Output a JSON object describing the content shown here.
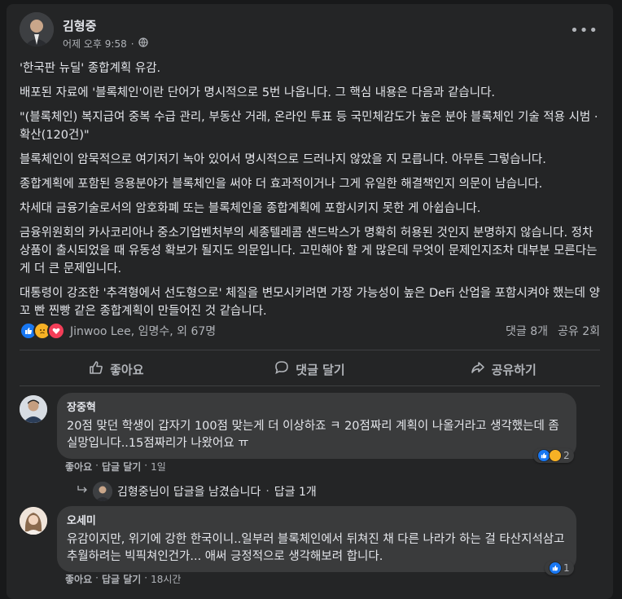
{
  "post": {
    "author": "김형중",
    "time": "어제 오후 9:58",
    "dot": "·",
    "more": "•••",
    "paragraphs": [
      "'한국판 뉴딜' 종합계획 유감.",
      "배포된 자료에 '블록체인'이란 단어가 명시적으로 5번 나옵니다. 그 핵심 내용은 다음과 같습니다.",
      "\"(블록체인) 복지급여 중복 수급 관리, 부동산 거래, 온라인 투표 등 국민체감도가 높은 분야 블록체인 기술 적용 시범 · 확산(120건)\"",
      "블록체인이 암묵적으로 여기저기 녹아 있어서 명시적으로 드러나지 않았을 지 모릅니다. 아무튼 그렇습니다.",
      "종합계획에 포함된 응용분야가 블록체인을 써야 더 효과적이거나 그게 유일한 해결책인지 의문이 남습니다.",
      "차세대 금융기술로서의 암호화폐 또는 블록체인을 종합계획에 포함시키지 못한 게 아쉽습니다.",
      "금융위원회의 카사코리아나 중소기업벤처부의 세종텔레콤 샌드박스가 명확히 허용된 것인지 분명하지 않습니다. 정차 상품이 출시되었을 때 유동성 확보가 될지도 의문입니다. 고민해야 할 게 많은데 무엇이 문제인지조차 대부분 모른다는 게 더 큰 문제입니다.",
      "대통령이 강조한 '추격형에서 선도형으로' 체질을 변모시키려면 가장 가능성이 높은 DeFi 산업을 포함시켜야 했는데 양꼬 빤 찐빵 같은 종합계획이 만들어진 것 같습니다."
    ],
    "reactions_text": "Jinwoo Lee, 임명수, 외 67명",
    "comments_count": "댓글 8개",
    "shares_count": "공유 2회",
    "actions": {
      "like": "좋아요",
      "comment": "댓글 달기",
      "share": "공유하기"
    }
  },
  "comments": [
    {
      "name": "장중혁",
      "text": "20점 맞던 학생이 갑자기 100점 맞는게 더 이상하죠 ㅋ 20점짜리 계획이 나올거라고 생각했는데 좀 실망입니다..15점짜리가 나왔어요 ㅠ",
      "like": "좋아요",
      "reply": "답글 달기",
      "time": "1일",
      "reaction_count": "2",
      "reply_summary": "김형중님이 답글을 남겼습니다",
      "reply_count": "답글 1개"
    },
    {
      "name": "오세미",
      "text": "유감이지만, 위기에 강한 한국이니..일부러 블록체인에서 뒤쳐진 채 다른 나라가 하는 걸 타산지석삼고 추월하려는 빅픽쳐인건가... 애써 긍정적으로 생각해보려 합니다.",
      "like": "좋아요",
      "reply": "답글 달기",
      "time": "18시간",
      "reaction_count": "1"
    }
  ],
  "colors": {
    "background": "#18191a",
    "card": "#242526",
    "bubble": "#3a3b3c",
    "like_blue": "#1877f2",
    "love_red": "#f33e58",
    "sad_yellow": "#f7b125"
  }
}
